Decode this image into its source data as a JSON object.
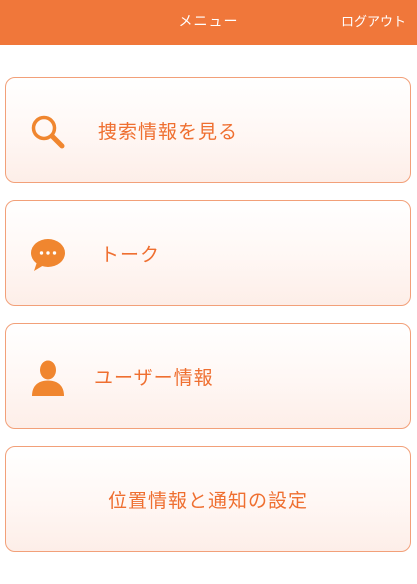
{
  "header": {
    "title": "メニュー",
    "logout_label": "ログアウト"
  },
  "colors": {
    "accent": "#f0773a",
    "card_border": "#f2a079",
    "label": "#ef6f30"
  },
  "menu": {
    "items": [
      {
        "label": "捜索情報を見る",
        "icon": "search-icon"
      },
      {
        "label": "トーク",
        "icon": "chat-bubble-icon"
      },
      {
        "label": "ユーザー情報",
        "icon": "user-icon"
      },
      {
        "label": "位置情報と通知の設定",
        "icon": ""
      }
    ]
  }
}
